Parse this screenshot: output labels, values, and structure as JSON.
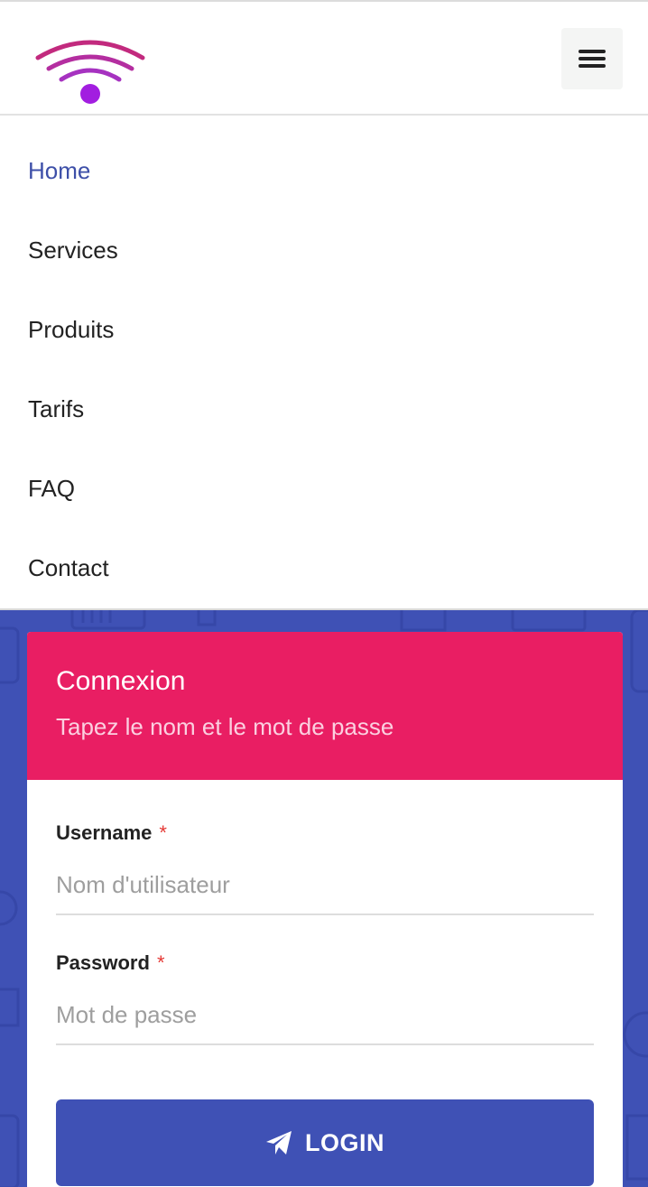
{
  "header": {
    "logo_icon": "wifi-icon",
    "menu_icon": "hamburger-icon"
  },
  "nav": {
    "items": [
      {
        "label": "Home",
        "active": true
      },
      {
        "label": "Services"
      },
      {
        "label": "Produits"
      },
      {
        "label": "Tarifs"
      },
      {
        "label": "FAQ"
      },
      {
        "label": "Contact"
      }
    ]
  },
  "login": {
    "title": "Connexion",
    "subtitle": "Tapez le nom et le mot de passe",
    "username_label": "Username",
    "username_placeholder": "Nom d'utilisateur",
    "password_label": "Password",
    "password_placeholder": "Mot de passe",
    "required_mark": "*",
    "button_label": "LOGIN",
    "button_icon": "paper-plane-icon"
  },
  "colors": {
    "primary": "#3f51b5",
    "accent": "#e91e63",
    "nav_active": "#3d4fa8",
    "required": "#e53935"
  }
}
